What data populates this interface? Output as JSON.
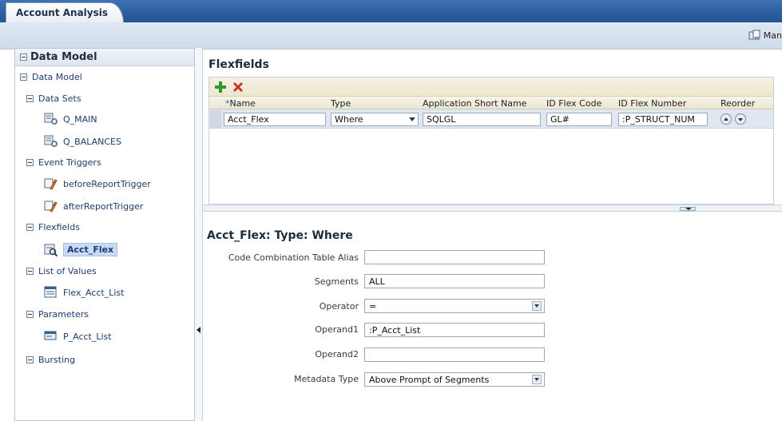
{
  "app_tab": "Account Analysis",
  "toolbar": {
    "manage_label": "Man"
  },
  "left_panel": {
    "header": "Data Model",
    "root": "Data Model",
    "sections": {
      "data_sets": "Data Sets",
      "event_triggers": "Event Triggers",
      "flexfields": "Flexfields",
      "lov": "List of Values",
      "parameters": "Parameters",
      "bursting": "Bursting"
    },
    "items": {
      "q_main": "Q_MAIN",
      "q_balances": "Q_BALANCES",
      "before_trigger": "beforeReportTrigger",
      "after_trigger": "afterReportTrigger",
      "acct_flex": "Acct_Flex",
      "flex_acct_list": "Flex_Acct_List",
      "p_acct_list": "P_Acct_List"
    }
  },
  "flexfields": {
    "title": "Flexfields",
    "columns": {
      "name": "Name",
      "type": "Type",
      "app_short_name": "Application Short Name",
      "id_flex_code": "ID Flex Code",
      "id_flex_number": "ID Flex Number",
      "reorder": "Reorder"
    },
    "row": {
      "name": "Acct_Flex",
      "type": "Where",
      "app_short_name": "SQLGL",
      "id_flex_code": "GL#",
      "id_flex_number": ":P_STRUCT_NUM"
    }
  },
  "detail": {
    "title": "Acct_Flex: Type: Where",
    "labels": {
      "alias": "Code Combination Table Alias",
      "segments": "Segments",
      "operator": "Operator",
      "operand1": "Operand1",
      "operand2": "Operand2",
      "metadata_type": "Metadata Type"
    },
    "values": {
      "alias": "",
      "segments": "ALL",
      "operator": "=",
      "operand1": ":P_Acct_List",
      "operand2": "",
      "metadata_type": "Above Prompt of Segments"
    }
  }
}
